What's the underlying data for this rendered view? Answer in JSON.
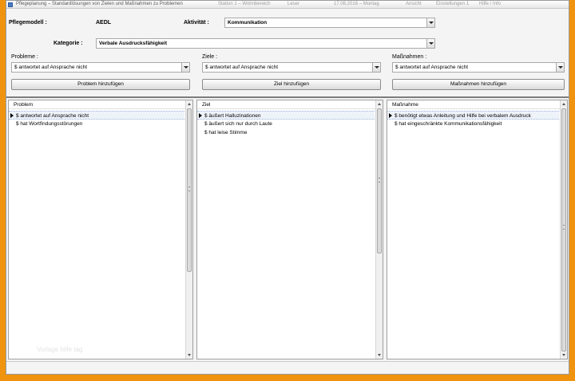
{
  "window": {
    "title": "Pflegeplanung – Standardlösungen von Zielen und Maßnahmen zu Problemen",
    "ghost_items": [
      "Station 1 – Wohnbereich",
      "Leser",
      "17.08.2016 – Montag",
      "Ansicht",
      "Einstellungen 1",
      "Hilfe / Info"
    ]
  },
  "filters": {
    "pflegemodell_label": "Pflegemodell :",
    "pflegemodell_value": "AEDL",
    "aktivitaet_label": "Aktivität :",
    "aktivitaet_value": "Kommunikation",
    "kategorie_label": "Kategorie :",
    "kategorie_value": "Verbale Ausdrucksfähigkeit"
  },
  "selectors": {
    "probleme_label": "Probleme :",
    "probleme_value": "$ antwortet auf Ansprache nicht",
    "ziele_label": "Ziele :",
    "ziele_value": "$ antwortet auf Ansprache nicht",
    "massnahmen_label": "Maßnahmen :",
    "massnahmen_value": "$ antwortet auf Ansprache nicht"
  },
  "buttons": {
    "problem_add": "Problem hinzufügen",
    "ziel_add": "Ziel hinzufügen",
    "massnahmen_add": "Maßnahmen hinzufügen"
  },
  "panels": {
    "problem": {
      "header": "Problem",
      "rows": [
        "$ antwortet auf Ansprache nicht",
        "$ hat Wortfindungsstörungen"
      ]
    },
    "ziel": {
      "header": "Ziel",
      "rows": [
        "$ äußert Halluzinationen",
        "$ äußert sich nur durch Laute",
        "$ hat leise Stimme"
      ]
    },
    "massnahme": {
      "header": "Maßnahme",
      "rows": [
        "$ benötigt etwas Anleitung und Hilfe bei verbalem Ausdruck",
        "$ hat eingeschränkte Kommunikationsfähigkeit"
      ]
    }
  },
  "watermark": "Vorlage hilfe tag"
}
